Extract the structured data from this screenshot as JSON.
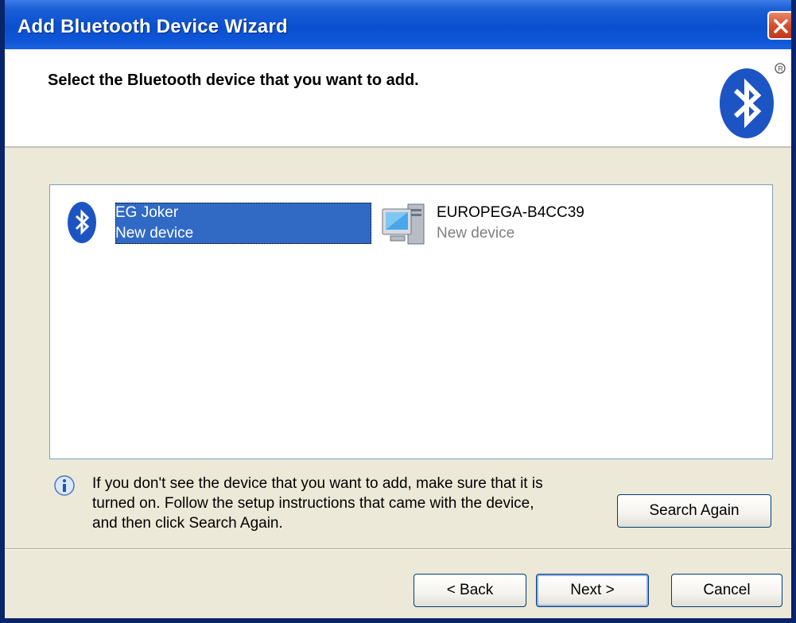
{
  "window": {
    "title": "Add Bluetooth Device Wizard"
  },
  "header": {
    "title": "Select the Bluetooth device that you want to add."
  },
  "devices": [
    {
      "name": "EG Joker",
      "status": "New device",
      "icon": "bluetooth-icon",
      "selected": true
    },
    {
      "name": "EUROPEGA-B4CC39",
      "status": "New device",
      "icon": "computer-icon",
      "selected": false
    }
  ],
  "info": {
    "line1": "If you don't see the device that you want to add, make sure that it is",
    "line2": "turned on. Follow the setup instructions that came with the device,",
    "line3": "and then click Search Again."
  },
  "buttons": {
    "search_again": "Search Again",
    "back": "< Back",
    "next": "Next >",
    "cancel": "Cancel"
  },
  "colors": {
    "titlebar": "#0a4fcf",
    "selection": "#316ac5",
    "bluetooth": "#1d54c4"
  }
}
